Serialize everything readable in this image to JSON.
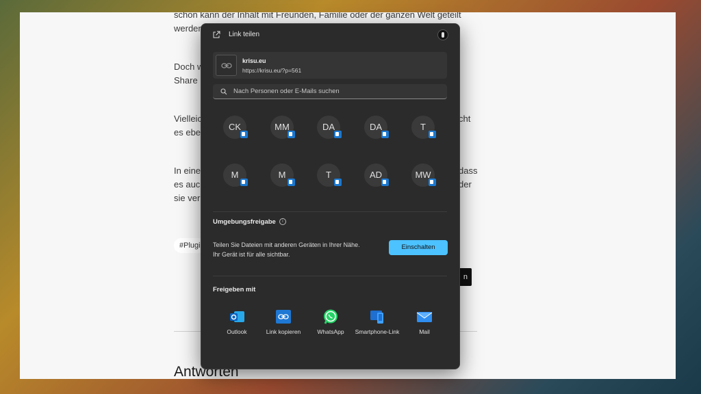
{
  "article": {
    "line1": "schon kann der Inhalt mit Freunden, Familie oder der ganzen Welt geteilt",
    "line2": "werden.",
    "p2a": "Doch w",
    "p2b": "Share l",
    "p3a": "Vielleic",
    "p3a_right": "cht",
    "p3b": "es ebe",
    "p4a": "In einer",
    "p4a_right": "dass",
    "p4b": "es auch",
    "p4b_right": "der",
    "p4c": "sie verl",
    "tag": "#Plugi",
    "black_btn": "n",
    "heading": "Antworten"
  },
  "dialog": {
    "title": "Link teilen",
    "link": {
      "name": "krisu.eu",
      "url": "https://krisu.eu/?p=561"
    },
    "search_placeholder": "Nach Personen oder E-Mails suchen",
    "contacts": [
      {
        "initials": "CK"
      },
      {
        "initials": "MM"
      },
      {
        "initials": "DA"
      },
      {
        "initials": "DA"
      },
      {
        "initials": "T"
      },
      {
        "initials": "M"
      },
      {
        "initials": "M"
      },
      {
        "initials": "T"
      },
      {
        "initials": "AD"
      },
      {
        "initials": "MW"
      }
    ],
    "nearby": {
      "title": "Umgebungsfreigabe",
      "description": "Teilen Sie Dateien mit anderen Geräten in Ihrer Nähe. Ihr Gerät ist für alle sichtbar.",
      "button": "Einschalten"
    },
    "share_with": {
      "title": "Freigeben mit",
      "apps": [
        {
          "label": "Outlook",
          "icon": "outlook-icon"
        },
        {
          "label": "Link kopieren",
          "icon": "link-icon"
        },
        {
          "label": "WhatsApp",
          "icon": "whatsapp-icon"
        },
        {
          "label": "Smartphone-Link",
          "icon": "phone-link-icon"
        },
        {
          "label": "Mail",
          "icon": "mail-icon"
        }
      ]
    }
  },
  "colors": {
    "accent": "#4cc2ff",
    "dialog_bg": "#2b2b2b",
    "outlook_badge": "#1a78d0"
  }
}
